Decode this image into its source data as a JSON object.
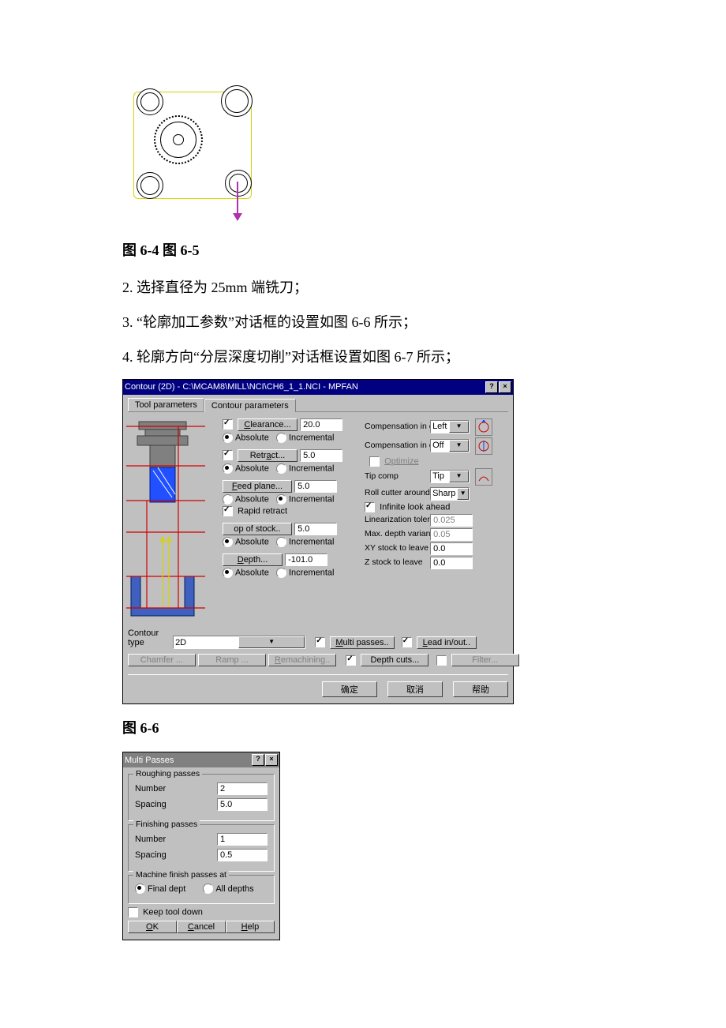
{
  "text": {
    "caption_6_4_5": "图 6-4 图 6-5",
    "p2": "2. 选择直径为 25mm 端铣刀；",
    "p3": "3. “轮廓加工参数”对话框的设置如图 6-6 所示；",
    "p4": "4. 轮廓方向“分层深度切削”对话框设置如图 6-7 所示；",
    "caption_6_6": "图 6-6"
  },
  "dialog": {
    "title": "Contour (2D) - C:\\MCAM8\\MILL\\NCI\\CH6_1_1.NCI - MPFAN",
    "tabs": {
      "tool": "Tool parameters",
      "contour": "Contour parameters"
    },
    "clearance_label": "Clearance...",
    "clearance_val": "20.0",
    "retract_label": "Retract...",
    "retract_val": "5.0",
    "feedplane_label": "Feed plane...",
    "feedplane_val": "5.0",
    "rapid_retract": "Rapid retract",
    "topstock_label": "op of stock..",
    "topstock_val": "5.0",
    "depth_label": "Depth...",
    "depth_val": "-101.0",
    "absolute": "Absolute",
    "incremental": "Incremental",
    "comp_comp": "Compensation in computer",
    "comp_comp_val": "Left",
    "comp_ctrl": "Compensation in control",
    "comp_ctrl_val": "Off",
    "optimize": "Optimize",
    "tip_comp_lbl": "Tip comp",
    "tip_comp_val": "Tip",
    "roll_lbl": "Roll cutter around",
    "roll_val": "Sharp",
    "inf_look": "Infinite look ahead",
    "lin_tol_lbl": "Linearization tolerance",
    "lin_tol_val": "0.025",
    "max_depth_lbl": "Max. depth variance",
    "max_depth_val": "0.05",
    "xy_stock_lbl": "XY stock to leave",
    "xy_stock_val": "0.0",
    "z_stock_lbl": "Z stock to leave",
    "z_stock_val": "0.0",
    "contour_type_lbl": "Contour type",
    "contour_type_val": "2D",
    "multi_passes": "ulti passes..",
    "lead_inout": "ead in/out..",
    "chamfer": "Chamfer ...",
    "ramp": "Ramp ...",
    "remachining": "emachining..",
    "depth_cuts": "Depth cuts...",
    "filter": "Filter...",
    "ok": "确定",
    "cancel": "取消",
    "help": "帮助"
  },
  "multi": {
    "title": "Multi Passes",
    "roughing": "Roughing passes",
    "finishing": "Finishing passes",
    "number": "Number",
    "spacing": "Spacing",
    "r_num": "2",
    "r_sp": "5.0",
    "f_num": "1",
    "f_sp": "0.5",
    "mfp": "Machine finish passes at",
    "final_dept": "Final dept",
    "all_depths": "All depths",
    "keep": "Keep tool down",
    "ok": "OK",
    "cancel": "Cancel",
    "help": "Help"
  }
}
